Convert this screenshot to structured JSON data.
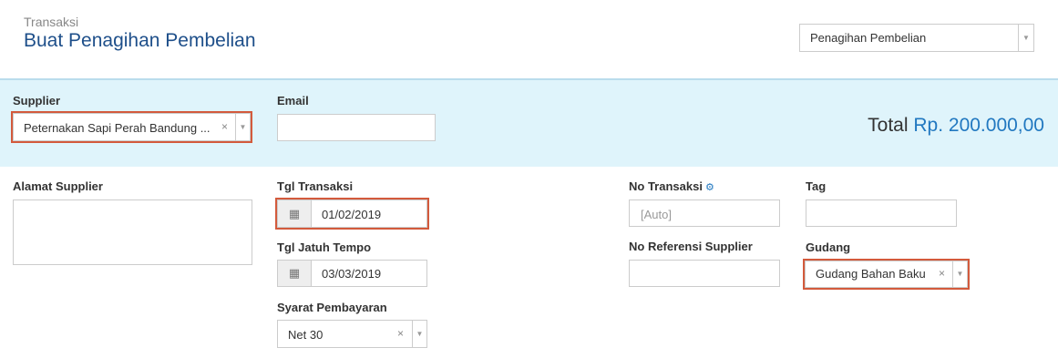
{
  "header": {
    "breadcrumb": "Transaksi",
    "title": "Buat Penagihan Pembelian",
    "type_select": "Penagihan Pembelian"
  },
  "band": {
    "supplier_label": "Supplier",
    "supplier_value": "Peternakan Sapi Perah Bandung ...",
    "email_label": "Email",
    "email_value": "",
    "total_label": "Total",
    "total_amount": "Rp. 200.000,00"
  },
  "form": {
    "alamat_label": "Alamat Supplier",
    "tgl_transaksi_label": "Tgl Transaksi",
    "tgl_transaksi_value": "01/02/2019",
    "tgl_jatuh_tempo_label": "Tgl Jatuh Tempo",
    "tgl_jatuh_tempo_value": "03/03/2019",
    "syarat_label": "Syarat Pembayaran",
    "syarat_value": "Net 30",
    "no_transaksi_label": "No Transaksi",
    "no_transaksi_placeholder": "[Auto]",
    "no_referensi_label": "No Referensi Supplier",
    "tag_label": "Tag",
    "gudang_label": "Gudang",
    "gudang_value": "Gudang Bahan Baku"
  },
  "icons": {
    "clear": "×",
    "dropdown": "▼",
    "calendar": "▦",
    "gear": "⚙"
  },
  "colors": {
    "accent": "#2178c0",
    "title": "#1e4f8a",
    "highlight": "#d35a3c",
    "band_bg": "#dff4fb"
  }
}
